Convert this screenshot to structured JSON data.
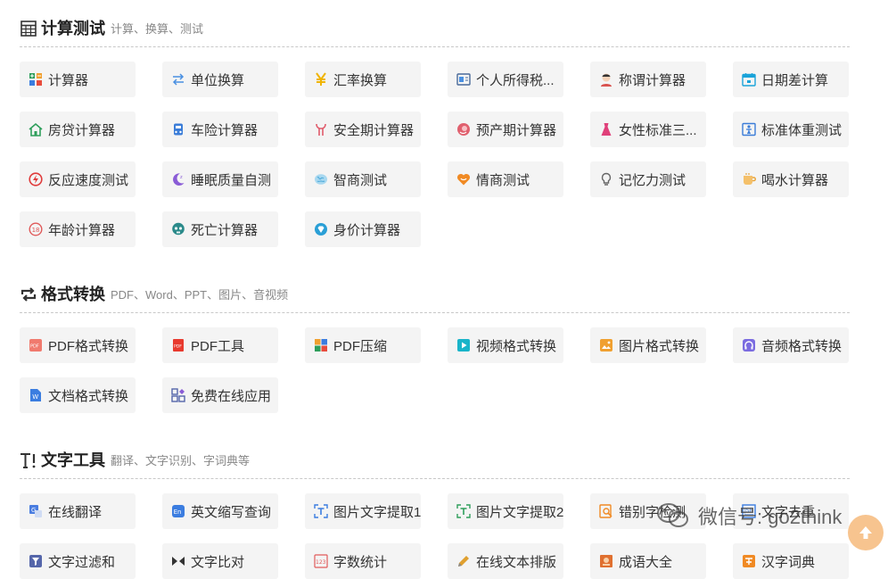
{
  "sections": [
    {
      "title": "计算测试",
      "subtitle": "计算、换算、测试",
      "icon": "calculator-grid-icon",
      "items": [
        {
          "label": "计算器",
          "icon": "calculator-icon",
          "color": "#2e9e5b"
        },
        {
          "label": "单位换算",
          "icon": "swap-arrows-icon",
          "color": "#4a90e2"
        },
        {
          "label": "汇率换算",
          "icon": "yen-icon",
          "color": "#f0b400"
        },
        {
          "label": "个人所得税...",
          "icon": "tax-card-icon",
          "color": "#4a90e2"
        },
        {
          "label": "称谓计算器",
          "icon": "person-icon",
          "color": "#d9534f"
        },
        {
          "label": "日期差计算",
          "icon": "calendar-icon",
          "color": "#1aa3d9"
        },
        {
          "label": "房贷计算器",
          "icon": "house-icon",
          "color": "#2e9e5b"
        },
        {
          "label": "车险计算器",
          "icon": "car-icon",
          "color": "#3b7dd8"
        },
        {
          "label": "安全期计算器",
          "icon": "uterus-icon",
          "color": "#e05a6a"
        },
        {
          "label": "预产期计算器",
          "icon": "baby-icon",
          "color": "#e0606e"
        },
        {
          "label": "女性标准三...",
          "icon": "dress-icon",
          "color": "#e0407a"
        },
        {
          "label": "标准体重测试",
          "icon": "body-scale-icon",
          "color": "#3b7dd8"
        },
        {
          "label": "反应速度测试",
          "icon": "lightning-icon",
          "color": "#e03c3c"
        },
        {
          "label": "睡眠质量自测",
          "icon": "moon-icon",
          "color": "#8a5cd6"
        },
        {
          "label": "智商测试",
          "icon": "brain-icon",
          "color": "#4aa8d8"
        },
        {
          "label": "情商测试",
          "icon": "heart-icon",
          "color": "#f08a24"
        },
        {
          "label": "记忆力测试",
          "icon": "lightbulb-icon",
          "color": "#666666"
        },
        {
          "label": "喝水计算器",
          "icon": "cup-icon",
          "color": "#e8a43a"
        },
        {
          "label": "年龄计算器",
          "icon": "age-badge-icon",
          "color": "#e05a5a"
        },
        {
          "label": "死亡计算器",
          "icon": "skull-icon",
          "color": "#2b8a8a"
        },
        {
          "label": "身价计算器",
          "icon": "diamond-icon",
          "color": "#2a9fd6"
        }
      ]
    },
    {
      "title": "格式转换",
      "subtitle": "PDF、Word、PPT、图片、音视频",
      "icon": "repeat-arrows-icon",
      "items": [
        {
          "label": "PDF格式转换",
          "icon": "pdf-icon",
          "color": "#e84c3d"
        },
        {
          "label": "PDF工具",
          "icon": "pdf-tool-icon",
          "color": "#e83a2e"
        },
        {
          "label": "PDF压缩",
          "icon": "zip-icon",
          "color": "#f0a030"
        },
        {
          "label": "视频格式转换",
          "icon": "play-icon",
          "color": "#19b4c9"
        },
        {
          "label": "图片格式转换",
          "icon": "image-icon",
          "color": "#f0a030"
        },
        {
          "label": "音频格式转换",
          "icon": "headphones-icon",
          "color": "#7b6ce0"
        },
        {
          "label": "文档格式转换",
          "icon": "word-doc-icon",
          "color": "#3b7de0"
        },
        {
          "label": "免费在线应用",
          "icon": "apps-icon",
          "color": "#5566aa"
        }
      ]
    },
    {
      "title": "文字工具",
      "subtitle": "翻译、文字识别、字词典等",
      "icon": "text-tool-icon",
      "items": [
        {
          "label": "在线翻译",
          "icon": "translate-icon",
          "color": "#4a7de0"
        },
        {
          "label": "英文缩写查询",
          "icon": "en-icon",
          "color": "#3b7de0"
        },
        {
          "label": "图片文字提取1",
          "icon": "text-extract-icon",
          "color": "#3b7de0"
        },
        {
          "label": "图片文字提取2",
          "icon": "text-extract-green-icon",
          "color": "#2e9e5b"
        },
        {
          "label": "错别字检测",
          "icon": "magnifier-doc-icon",
          "color": "#f08a24"
        },
        {
          "label": "文字去重",
          "icon": "dedupe-icon",
          "color": "#3b7de0"
        },
        {
          "label": "文字过滤和",
          "icon": "filter-icon",
          "color": "#5566aa"
        },
        {
          "label": "文字比对",
          "icon": "compare-icon",
          "color": "#333333"
        },
        {
          "label": "字数统计",
          "icon": "count-icon",
          "color": "#e05a5a"
        },
        {
          "label": "在线文本排版",
          "icon": "pen-icon",
          "color": "#e0a030"
        },
        {
          "label": "成语大全",
          "icon": "book-icon",
          "color": "#e07030"
        },
        {
          "label": "汉字词典",
          "icon": "dictionary-icon",
          "color": "#f08a24"
        }
      ]
    }
  ],
  "watermark": {
    "text": "微信号: go2think",
    "icon": "wechat-icon"
  },
  "scroll_top": {
    "icon": "arrow-up-icon",
    "color": "#f7c48f"
  }
}
